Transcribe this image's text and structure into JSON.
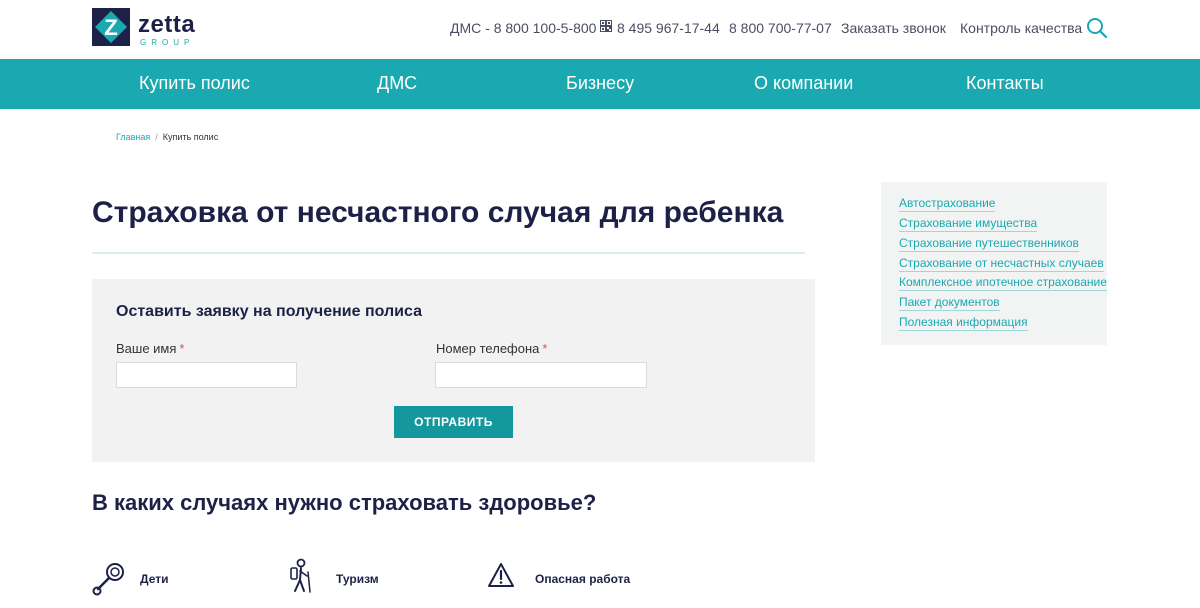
{
  "header": {
    "logo_name": "zetta",
    "logo_sub": "GROUP",
    "phone_dms": "ДМС - 8 800 100-5-800",
    "phone_moscow": "8 495 967-17-44",
    "phone_free": "8 800 700-77-07",
    "callback": "Заказать звонок",
    "quality": "Контроль качества",
    "search_icon": "search-icon",
    "qr_icon": "qr-icon"
  },
  "nav": {
    "items": [
      {
        "label": "Купить полис"
      },
      {
        "label": "ДМС"
      },
      {
        "label": "Бизнесу"
      },
      {
        "label": "О компании"
      },
      {
        "label": "Контакты"
      }
    ]
  },
  "breadcrumb": {
    "home": "Главная",
    "separator": "/",
    "current": "Купить полис"
  },
  "page": {
    "title": "Страховка от несчастного случая для ребенка"
  },
  "form": {
    "heading": "Оставить заявку на получение полиса",
    "name_label": "Ваше имя",
    "phone_label": "Номер телефона",
    "required_mark": "*",
    "name_value": "",
    "phone_value": "",
    "submit": "ОТПРАВИТЬ"
  },
  "cases": {
    "title": "В каких случаях нужно страховать здоровье?",
    "items": [
      {
        "label": "Дети",
        "icon": "rattle-icon"
      },
      {
        "label": "Туризм",
        "icon": "hiker-icon"
      },
      {
        "label": "Опасная работа",
        "icon": "warning-icon"
      }
    ]
  },
  "sidebar": {
    "links": [
      {
        "label": "Автострахование"
      },
      {
        "label": "Страхование имущества"
      },
      {
        "label": "Страхование путешественников"
      },
      {
        "label": "Страхование от несчастных случаев"
      },
      {
        "label": "Комплексное ипотечное страхование"
      },
      {
        "label": "Пакет документов"
      },
      {
        "label": "Полезная информация"
      }
    ]
  },
  "colors": {
    "accent": "#1aa9b0",
    "button": "#15979e",
    "text_dark": "#1d2147",
    "panel": "#f2f2f2",
    "required": "#d9534f"
  }
}
